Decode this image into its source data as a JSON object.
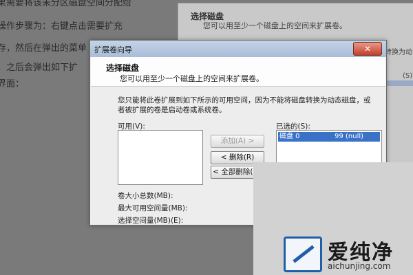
{
  "article": {
    "lines": [
      "果需要将该未分区磁盘空间分配给",
      "操作步骤为：右键点击需要扩充",
      "存，然后在弹出的菜单",
      "，之后会弹出如下扩",
      "界面："
    ]
  },
  "background_dialog": {
    "title": "选择磁盘",
    "subtitle": "您可以用至少一个磁盘上的空间来扩展卷。",
    "side_text": "转换为动",
    "side_label": "(S):"
  },
  "dialog": {
    "window_title": "扩展卷向导",
    "close_label": "✕",
    "header_title": "选择磁盘",
    "header_subtitle": "您可以用至少一个磁盘上的空间来扩展卷。",
    "description": "您只能将此卷扩展到如下所示的可用空间，因为不能将磁盘转换为动态磁盘，或者被扩展的卷是启动卷或系统卷。",
    "available_label": "可用(V):",
    "selected_label": "已选的(S):",
    "selected_rows": [
      {
        "disk": "磁盘 0",
        "size": "99",
        "status": "(null)"
      }
    ],
    "buttons": {
      "add": "添加(A) >",
      "remove": "< 删除(R)",
      "remove_all": "< 全部删除(M)"
    },
    "fields": {
      "total_size": "卷大小总数(MB):",
      "max_available": "最大可用空间量(MB):",
      "select_amount": "选择空间量(MB)(E):"
    }
  },
  "logo": {
    "brand": "爱纯净",
    "domain": "aichunjing.com"
  }
}
